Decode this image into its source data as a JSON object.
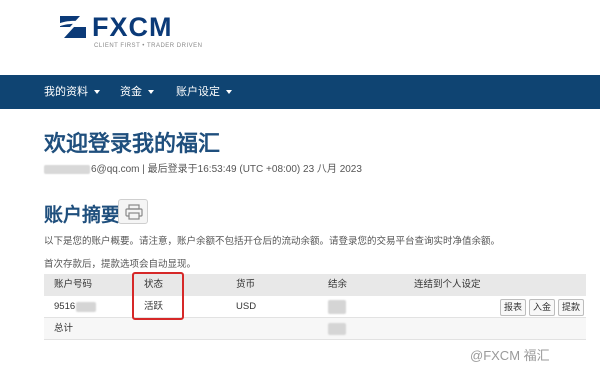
{
  "brand": {
    "logo_text": "FXCM",
    "tagline": "CLIENT FIRST • TRADER DRIVEN",
    "primary_color": "#0f4472",
    "title_color": "#1f4f7d",
    "highlight_color": "#d62828"
  },
  "nav": {
    "items": [
      {
        "label": "我的资料"
      },
      {
        "label": "资金"
      },
      {
        "label": "账户设定"
      }
    ]
  },
  "header": {
    "title": "欢迎登录我的福汇",
    "email_suffix": "6@qq.com",
    "last_login": "| 最后登录于16:53:49 (UTC +08:00) 23 八月 2023"
  },
  "summary": {
    "title": "账户摘要",
    "print_icon": "printer-icon",
    "note_1": "以下是您的账户概要。请注意，账户余额不包括开仓后的流动余额。请登录您的交易平台查询实时净值余额。",
    "note_2": "首次存款后，提款选项会自动显现。"
  },
  "table": {
    "headers": [
      "账户号码",
      "状态",
      "货币",
      "结余",
      "连结到个人设定"
    ],
    "rows": [
      {
        "account": "9516",
        "status": "活跃",
        "currency": "USD"
      }
    ],
    "total_label": "总计",
    "actions": [
      "报表",
      "入金",
      "提款"
    ]
  },
  "watermark": "@FXCM 福汇"
}
